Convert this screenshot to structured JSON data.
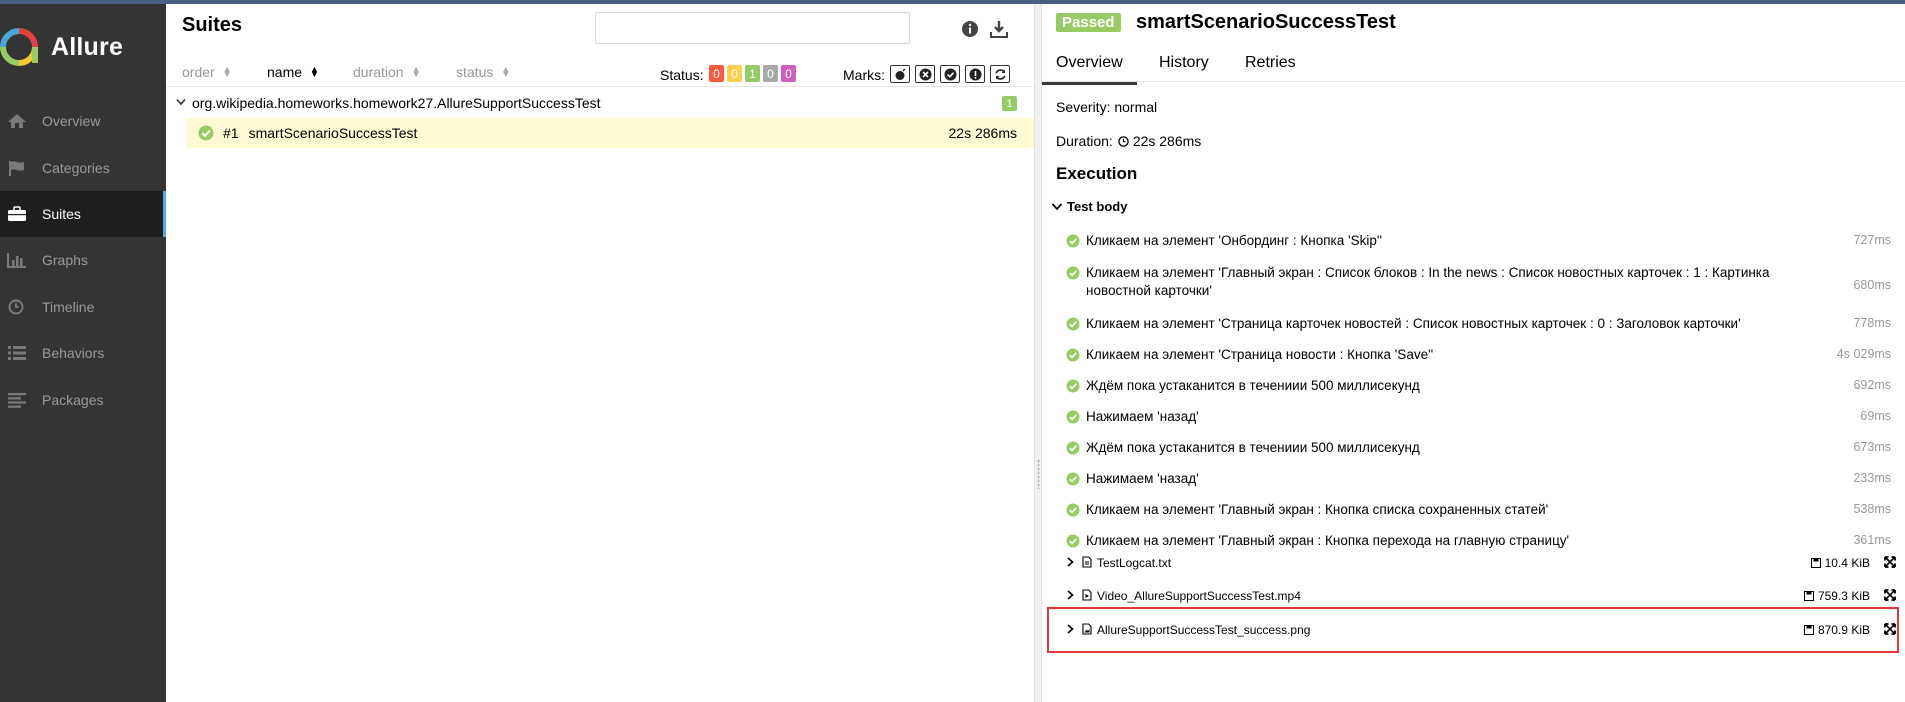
{
  "app": {
    "brand": "Allure"
  },
  "sidebar": {
    "items": [
      {
        "label": "Overview",
        "icon": "home-icon"
      },
      {
        "label": "Categories",
        "icon": "flag-icon"
      },
      {
        "label": "Suites",
        "icon": "briefcase-icon",
        "active": true
      },
      {
        "label": "Graphs",
        "icon": "bar-chart-icon"
      },
      {
        "label": "Timeline",
        "icon": "clock-icon"
      },
      {
        "label": "Behaviors",
        "icon": "list-icon"
      },
      {
        "label": "Packages",
        "icon": "align-left-icon"
      }
    ]
  },
  "suites": {
    "title": "Suites",
    "search": {
      "placeholder": "",
      "value": ""
    },
    "sort": {
      "order": "order",
      "name": "name",
      "duration": "duration",
      "status": "status"
    },
    "status_label": "Status:",
    "status_counts": [
      {
        "value": "0",
        "color": "#fd5a3e",
        "name": "failed"
      },
      {
        "value": "0",
        "color": "#ffd050",
        "name": "broken"
      },
      {
        "value": "1",
        "color": "#97cc64",
        "name": "passed"
      },
      {
        "value": "0",
        "color": "#aaaaaa",
        "name": "skipped"
      },
      {
        "value": "0",
        "color": "#d35ebe",
        "name": "unknown"
      }
    ],
    "marks_label": "Marks:",
    "group": {
      "name": "org.wikipedia.homeworks.homework27.AllureSupportSuccessTest",
      "count": "1"
    },
    "test": {
      "num": "#1",
      "name": "smartScenarioSuccessTest",
      "duration": "22s 286ms"
    }
  },
  "detail": {
    "status": "Passed",
    "title": "smartScenarioSuccessTest",
    "tabs": [
      "Overview",
      "History",
      "Retries"
    ],
    "severity": "Severity: normal",
    "duration_label": "Duration:",
    "duration": "22s 286ms",
    "execution_title": "Execution",
    "test_body": "Test body",
    "steps": [
      {
        "text": "Кликаем на элемент 'Онбординг : Кнопка 'Skip''",
        "dur": "727ms"
      },
      {
        "text": "Кликаем на элемент 'Главный экран : Список блоков : In the news : Список новостных карточек : 1 : Картинка новостной карточки'",
        "dur": "680ms"
      },
      {
        "text": "Кликаем на элемент 'Страница карточек новостей : Список новостных карточек : 0 : Заголовок карточки'",
        "dur": "778ms"
      },
      {
        "text": "Кликаем на элемент 'Страница новости : Кнопка 'Save''",
        "dur": "4s 029ms"
      },
      {
        "text": "Ждём пока устаканится в течениии 500 миллисекунд",
        "dur": "692ms"
      },
      {
        "text": "Нажимаем 'назад'",
        "dur": "69ms"
      },
      {
        "text": "Ждём пока устаканится в течениии 500 миллисекунд",
        "dur": "673ms"
      },
      {
        "text": "Нажимаем 'назад'",
        "dur": "233ms"
      },
      {
        "text": "Кликаем на элемент 'Главный экран : Кнопка списка сохраненных статей'",
        "dur": "538ms"
      },
      {
        "text": "Кликаем на элемент 'Главный экран : Кнопка перехода на главную страницу'",
        "dur": "361ms"
      }
    ],
    "attachments": [
      {
        "name": "TestLogcat.txt",
        "size": "10.4 KiB"
      },
      {
        "name": "Video_AllureSupportSuccessTest.mp4",
        "size": "759.3 KiB"
      },
      {
        "name": "AllureSupportSuccessTest_success.png",
        "size": "870.9 KiB"
      }
    ]
  },
  "colors": {
    "sidebar": "#343434",
    "passed": "#97cc64",
    "highlight": "#e0393e",
    "selected_row": "#fffad1"
  }
}
